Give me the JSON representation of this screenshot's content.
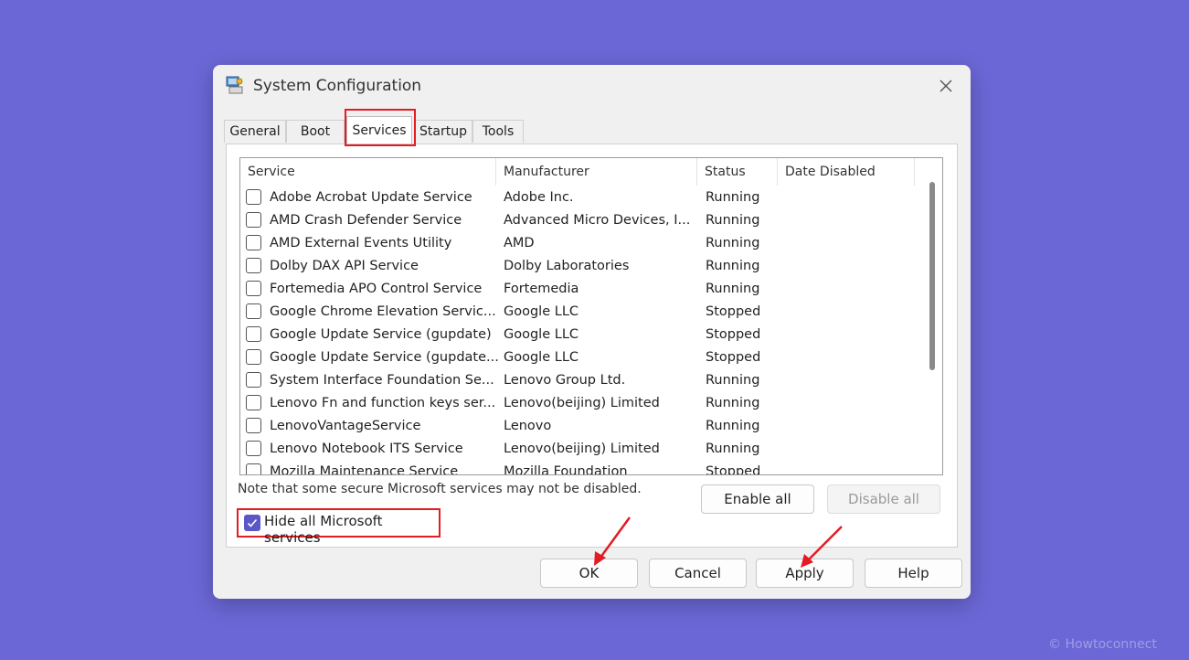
{
  "window": {
    "title": "System Configuration"
  },
  "tabs": [
    {
      "label": "General"
    },
    {
      "label": "Boot"
    },
    {
      "label": "Services"
    },
    {
      "label": "Startup"
    },
    {
      "label": "Tools"
    }
  ],
  "list": {
    "columns": [
      "Service",
      "Manufacturer",
      "Status",
      "Date Disabled"
    ],
    "rows": [
      {
        "service": "Adobe Acrobat Update Service",
        "manufacturer": "Adobe Inc.",
        "status": "Running",
        "date": ""
      },
      {
        "service": "AMD Crash Defender Service",
        "manufacturer": "Advanced Micro Devices, I...",
        "status": "Running",
        "date": ""
      },
      {
        "service": "AMD External Events Utility",
        "manufacturer": "AMD",
        "status": "Running",
        "date": ""
      },
      {
        "service": "Dolby DAX API Service",
        "manufacturer": "Dolby Laboratories",
        "status": "Running",
        "date": ""
      },
      {
        "service": "Fortemedia APO Control Service",
        "manufacturer": "Fortemedia",
        "status": "Running",
        "date": ""
      },
      {
        "service": "Google Chrome Elevation Servic...",
        "manufacturer": "Google LLC",
        "status": "Stopped",
        "date": ""
      },
      {
        "service": "Google Update Service (gupdate)",
        "manufacturer": "Google LLC",
        "status": "Stopped",
        "date": ""
      },
      {
        "service": "Google Update Service (gupdate...",
        "manufacturer": "Google LLC",
        "status": "Stopped",
        "date": ""
      },
      {
        "service": "System Interface Foundation Se...",
        "manufacturer": "Lenovo Group Ltd.",
        "status": "Running",
        "date": ""
      },
      {
        "service": "Lenovo Fn and function keys ser...",
        "manufacturer": "Lenovo(beijing) Limited",
        "status": "Running",
        "date": ""
      },
      {
        "service": "LenovoVantageService",
        "manufacturer": "Lenovo",
        "status": "Running",
        "date": ""
      },
      {
        "service": "Lenovo Notebook ITS Service",
        "manufacturer": "Lenovo(beijing) Limited",
        "status": "Running",
        "date": ""
      },
      {
        "service": "Mozilla Maintenance Service",
        "manufacturer": "Mozilla Foundation",
        "status": "Stopped",
        "date": ""
      }
    ]
  },
  "note": "Note that some secure Microsoft services may not be disabled.",
  "enable_all": "Enable all",
  "disable_all": "Disable all",
  "hide_ms": {
    "label": "Hide all Microsoft services",
    "checked": true
  },
  "buttons": {
    "ok": "OK",
    "cancel": "Cancel",
    "apply": "Apply",
    "help": "Help"
  },
  "watermark": "© Howtoconnect",
  "colors": {
    "background": "#6b67d6",
    "highlight": "#e31b23",
    "checkbox": "#5b57c8"
  }
}
